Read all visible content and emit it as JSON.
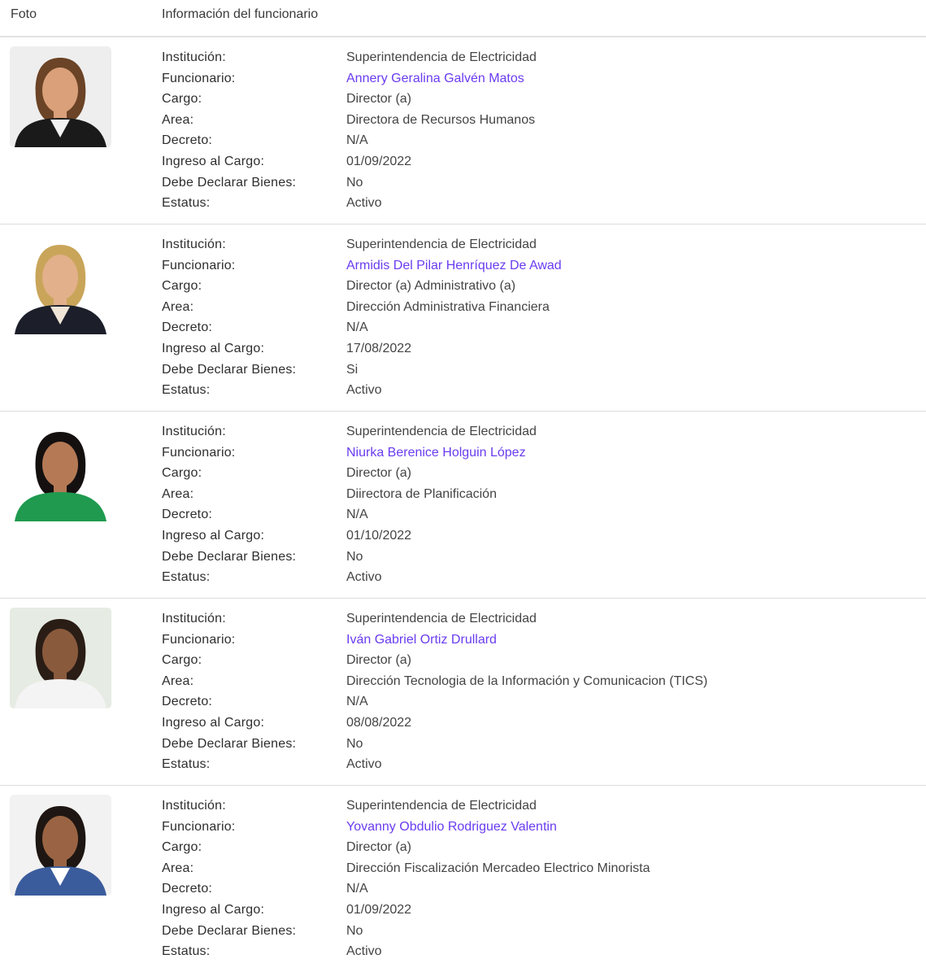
{
  "header": {
    "foto": "Foto",
    "info": "Información del funcionario"
  },
  "labels": {
    "institucion": "Institución:",
    "funcionario": "Funcionario:",
    "cargo": "Cargo:",
    "area": "Area:",
    "decreto": "Decreto:",
    "ingreso": "Ingreso al Cargo:",
    "declarar": "Debe Declarar Bienes:",
    "estatus": "Estatus:"
  },
  "colors": {
    "link": "#6a3cf0",
    "divider": "#dcdcdc"
  },
  "officials": [
    {
      "institucion": "Superintendencia de Electricidad",
      "funcionario": "Annery Geralina Galvén Matos",
      "cargo": "Director (a)",
      "area": "Directora de Recursos Humanos",
      "decreto": "N/A",
      "ingreso": "01/09/2022",
      "declarar": "No",
      "estatus": "Activo",
      "photo": {
        "bg": "#eeeeee",
        "hair": "#6b4326",
        "skin": "#d9a07a",
        "clothes": "#1a1a1a",
        "shirt": "#f2f2f2"
      }
    },
    {
      "institucion": "Superintendencia de Electricidad",
      "funcionario": "Armidis Del Pilar Henríquez De Awad",
      "cargo": "Director (a) Administrativo (a)",
      "area": "Dirección Administrativa Financiera",
      "decreto": "N/A",
      "ingreso": "17/08/2022",
      "declarar": "Si",
      "estatus": "Activo",
      "photo": {
        "bg": "#ffffff",
        "hair": "#c9a55a",
        "skin": "#e2b08a",
        "clothes": "#1c1f2a",
        "shirt": "#efe6d8"
      }
    },
    {
      "institucion": "Superintendencia de Electricidad",
      "funcionario": "Niurka Berenice Holguin López",
      "cargo": "Director (a)",
      "area": "Diirectora de Planificación",
      "decreto": "N/A",
      "ingreso": "01/10/2022",
      "declarar": "No",
      "estatus": "Activo",
      "photo": {
        "bg": "#ffffff",
        "hair": "#151010",
        "skin": "#b57a55",
        "clothes": "#1f9a4f",
        "shirt": "#1f9a4f"
      }
    },
    {
      "institucion": "Superintendencia de Electricidad",
      "funcionario": "Iván Gabriel Ortiz Drullard",
      "cargo": "Director (a)",
      "area": "Dirección Tecnologia de la Información y Comunicacion (TICS)",
      "decreto": "N/A",
      "ingreso": "08/08/2022",
      "declarar": "No",
      "estatus": "Activo",
      "photo": {
        "bg": "#e6ece3",
        "hair": "#2a1d16",
        "skin": "#8a5a3d",
        "clothes": "#f4f4f4",
        "shirt": "#f4f4f4"
      }
    },
    {
      "institucion": "Superintendencia de Electricidad",
      "funcionario": "Yovanny Obdulio Rodriguez Valentin",
      "cargo": "Director (a)",
      "area": "Dirección Fiscalización Mercadeo Electrico Minorista",
      "decreto": "N/A",
      "ingreso": "01/09/2022",
      "declarar": "No",
      "estatus": "Activo",
      "photo": {
        "bg": "#f2f2f2",
        "hair": "#1e1612",
        "skin": "#9a6444",
        "clothes": "#3b5c9c",
        "shirt": "#ffffff"
      }
    }
  ]
}
